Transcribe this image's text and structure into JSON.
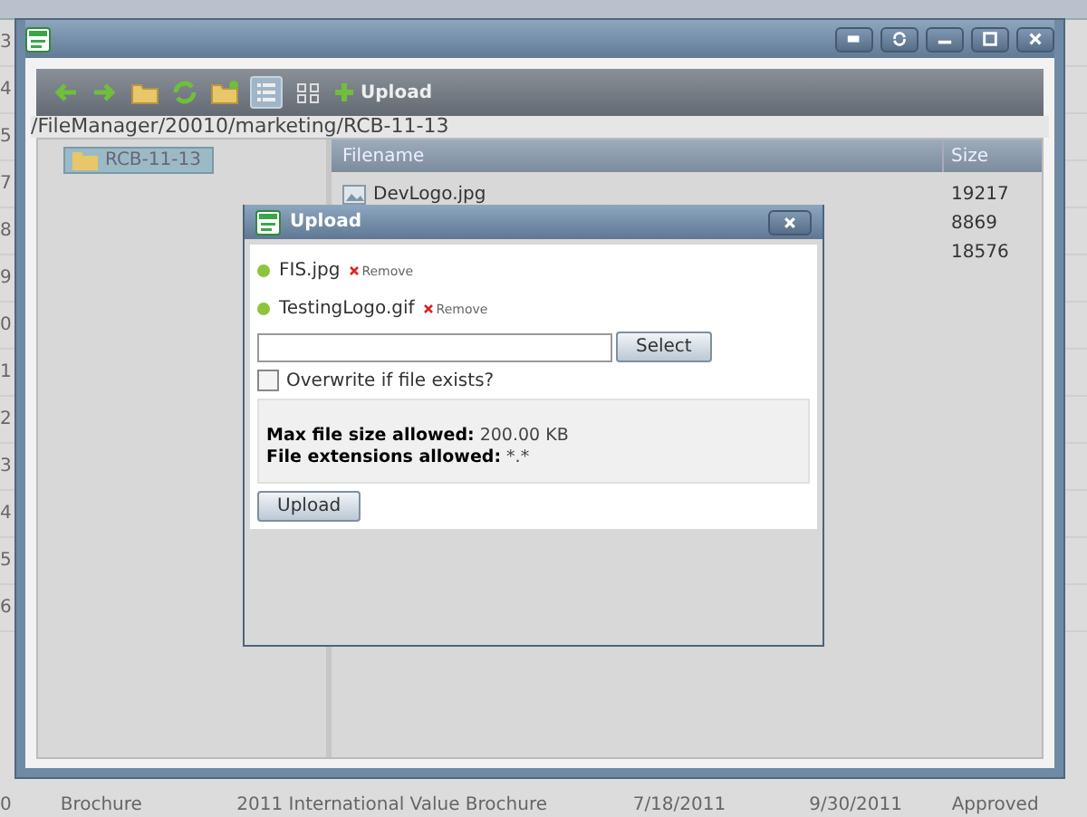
{
  "background_grid": {
    "row_numbers": [
      "3",
      "4",
      "5",
      "7",
      "8",
      "9",
      "0",
      "1",
      "2",
      "3",
      "4",
      "5",
      "6"
    ],
    "bottom_row": {
      "number": "0",
      "cells": [
        "Brochure",
        "2011 International Value Brochure",
        "7/18/2011",
        "9/30/2011",
        "Approved"
      ]
    }
  },
  "window": {
    "toolbar": {
      "upload_label": "Upload",
      "views": [
        {
          "kind": "list",
          "selected": true
        },
        {
          "kind": "grid",
          "selected": false
        }
      ]
    },
    "path": "/FileManager/20010/marketing/RCB-11-13",
    "tree": [
      {
        "label": "RCB-11-13",
        "selected": true
      }
    ],
    "table": {
      "columns": [
        "Filename",
        "Size"
      ],
      "rows": [
        {
          "name": "DevLogo.jpg",
          "size": "19217"
        },
        {
          "size": "8869"
        },
        {
          "size": "18576"
        }
      ]
    }
  },
  "dialog": {
    "title": "Upload",
    "files": [
      {
        "name": "FIS.jpg",
        "remove": "Remove"
      },
      {
        "name": "TestingLogo.gif",
        "remove": "Remove"
      }
    ],
    "select_button": "Select",
    "overwrite": {
      "label": "Overwrite if file exists?",
      "checked": false
    },
    "info": [
      {
        "label": "Max file size allowed:",
        "value": "200.00 KB"
      },
      {
        "label": "File extensions allowed:",
        "value": "*.*"
      }
    ],
    "upload_button": "Upload"
  }
}
